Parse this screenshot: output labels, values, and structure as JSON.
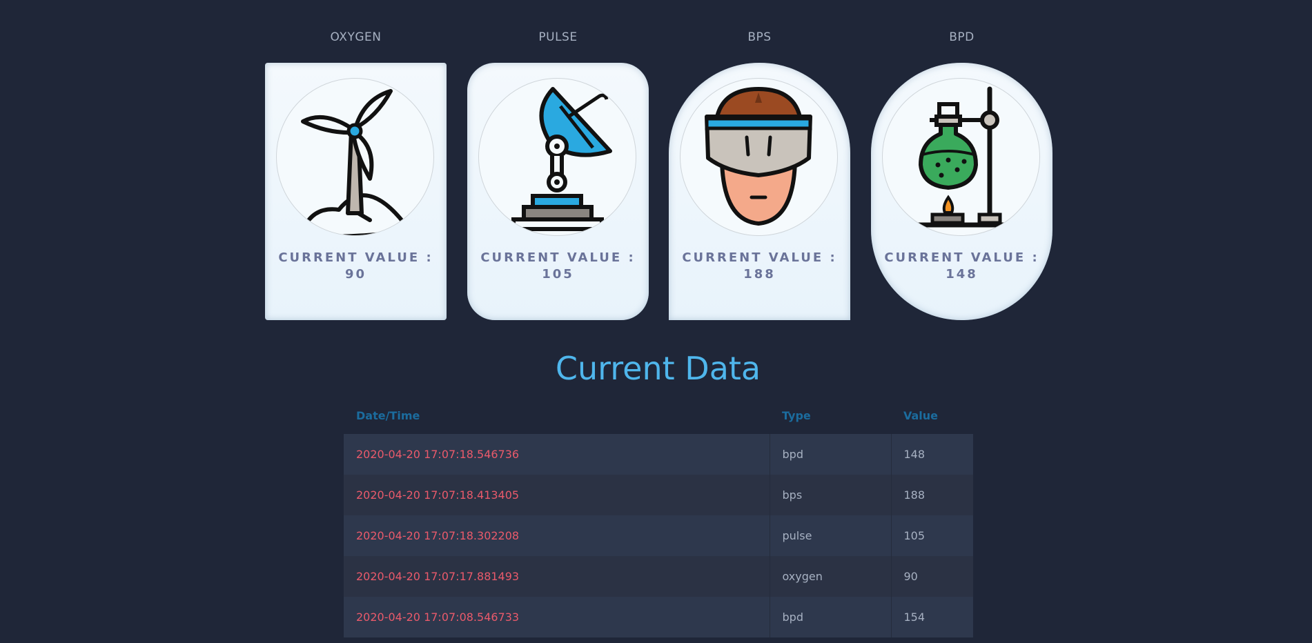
{
  "cards": [
    {
      "label": "OXYGEN",
      "icon": "wind-turbine-icon",
      "value_title": "CURRENT VALUE :",
      "value": "90"
    },
    {
      "label": "PULSE",
      "icon": "satellite-dish-icon",
      "value_title": "CURRENT VALUE :",
      "value": "105"
    },
    {
      "label": "BPS",
      "icon": "vr-headset-avatar-icon",
      "value_title": "CURRENT VALUE :",
      "value": "188"
    },
    {
      "label": "BPD",
      "icon": "lab-flask-icon",
      "value_title": "CURRENT VALUE :",
      "value": "148"
    }
  ],
  "table": {
    "title": "Current Data",
    "headers": {
      "datetime": "Date/Time",
      "type": "Type",
      "value": "Value"
    },
    "rows": [
      {
        "datetime": "2020-04-20 17:07:18.546736",
        "type": "bpd",
        "value": "148"
      },
      {
        "datetime": "2020-04-20 17:07:18.413405",
        "type": "bps",
        "value": "188"
      },
      {
        "datetime": "2020-04-20 17:07:18.302208",
        "type": "pulse",
        "value": "105"
      },
      {
        "datetime": "2020-04-20 17:07:17.881493",
        "type": "oxygen",
        "value": "90"
      },
      {
        "datetime": "2020-04-20 17:07:08.546733",
        "type": "bpd",
        "value": "154"
      }
    ]
  },
  "colors": {
    "background": "#1f2638",
    "accent": "#4fb6ec",
    "datetime_text": "#ea5a6b",
    "header_text": "#1b6c9e",
    "card_text": "#6a7399"
  }
}
